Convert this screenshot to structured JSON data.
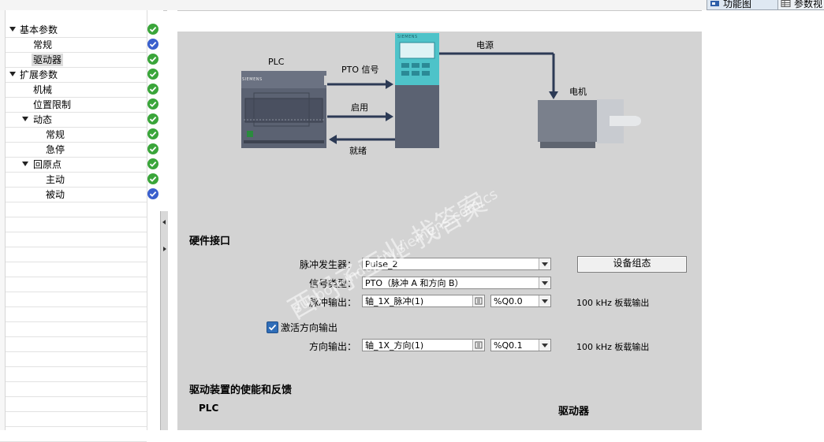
{
  "window": {
    "tabs": [
      {
        "label": "功能图",
        "icon": "function-view-icon"
      },
      {
        "label": "参数视",
        "icon": "parameter-view-icon"
      }
    ],
    "toolbar_icon": "view-options-icon"
  },
  "tree": {
    "items": [
      {
        "label": "基本参数",
        "level": 0,
        "expanded": true,
        "status": "ok-green"
      },
      {
        "label": "常规",
        "level": 1,
        "status": "ok-blue"
      },
      {
        "label": "驱动器",
        "level": 1,
        "selected": true,
        "status": "ok-green"
      },
      {
        "label": "扩展参数",
        "level": 0,
        "expanded": true,
        "status": "ok-green"
      },
      {
        "label": "机械",
        "level": 1,
        "status": "ok-green"
      },
      {
        "label": "位置限制",
        "level": 1,
        "status": "ok-green"
      },
      {
        "label": "动态",
        "level": 1,
        "expanded": true,
        "status": "ok-green"
      },
      {
        "label": "常规",
        "level": 2,
        "status": "ok-green"
      },
      {
        "label": "急停",
        "level": 2,
        "status": "ok-green"
      },
      {
        "label": "回原点",
        "level": 1,
        "expanded": true,
        "status": "ok-green"
      },
      {
        "label": "主动",
        "level": 2,
        "status": "ok-green"
      },
      {
        "label": "被动",
        "level": 2,
        "status": "ok-blue"
      }
    ]
  },
  "diagram": {
    "plc_label": "PLC",
    "plc_brand": "SIEMENS",
    "drive_brand": "SIEMENS",
    "pto_label": "PTO 信号",
    "enable_label": "启用",
    "ready_label": "就绪",
    "power_label": "电源",
    "motor_label": "电机"
  },
  "hardware": {
    "title": "硬件接口",
    "pulse_generator": {
      "label": "脉冲发生器：",
      "value": "Pulse_2"
    },
    "config_button": "设备组态",
    "signal_type": {
      "label": "信号类型：",
      "value": "PTO（脉冲 A 和方向 B）"
    },
    "pulse_output": {
      "label": "脉冲输出：",
      "value": "轴_1X_脉冲(1)",
      "address": "%Q0.0",
      "note": "100 kHz 板载输出"
    },
    "direction_checkbox": {
      "label": "激活方向输出",
      "checked": true
    },
    "direction_output": {
      "label": "方向输出：",
      "value": "轴_1X_方向(1)",
      "address": "%Q0.1",
      "note": "100 kHz 板载输出"
    }
  },
  "feedback": {
    "title": "驱动装置的使能和反馈",
    "col_plc": "PLC",
    "col_drive": "驱动器"
  },
  "watermark": {
    "line1": "西门子工业  找答案",
    "line2": "support.industry.siemens.com/cs"
  },
  "colors": {
    "panel_bg": "#d3d3d3",
    "check_green": "#3aa53a",
    "check_blue": "#3a5fcd",
    "drive_teal": "#4ec3c9",
    "device_gray": "#5b6272",
    "accent_blue": "#2f6db8"
  }
}
